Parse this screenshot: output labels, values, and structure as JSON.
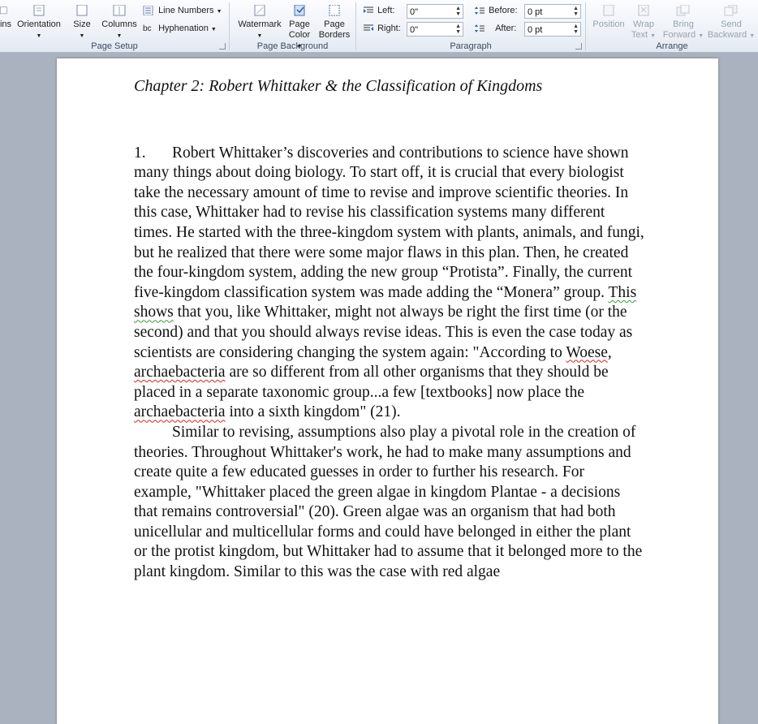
{
  "ribbon": {
    "page_setup": {
      "label": "Page Setup",
      "margins_label": "ins",
      "orientation_label": "Orientation",
      "size_label": "Size",
      "columns_label": "Columns",
      "line_numbers_label": "Line Numbers",
      "hyphenation_label": "Hyphenation"
    },
    "page_background": {
      "label": "Page Background",
      "watermark_label": "Watermark",
      "page_color_label_1": "Page",
      "page_color_label_2": "Color",
      "page_borders_label_1": "Page",
      "page_borders_label_2": "Borders"
    },
    "paragraph": {
      "label": "Paragraph",
      "left_label": "Left:",
      "left_value": "0\"",
      "right_label": "Right:",
      "right_value": "0\"",
      "before_label": "Before:",
      "before_value": "0 pt",
      "after_label": "After:",
      "after_value": "0 pt"
    },
    "arrange": {
      "label": "Arrange",
      "position_label": "Position",
      "wrap_text_label_1": "Wrap",
      "wrap_text_label_2": "Text",
      "bring_forward_label_1": "Bring",
      "bring_forward_label_2": "Forward",
      "send_backward_label_1": "Send",
      "send_backward_label_2": "Backward"
    }
  },
  "document": {
    "chapter_title": "Chapter 2: Robert Whittaker & the Classification of Kingdoms",
    "para1_number": "1.",
    "para1": {
      "t1": "Robert Whittaker’s discoveries and contributions to science have shown many things about doing biology. To start off, it is crucial that every biologist take the necessary amount of time to revise and improve scientific theories. In this case, Whittaker had to revise his classification systems many different times. He started with the three-kingdom system with plants, animals, and fungi, but he realized that there were some major flaws in this plan. Then, he created the four-kingdom system, adding the new group “Protista”. Finally, the current five-kingdom classification system was made adding the “Monera” group. ",
      "g1": "This shows",
      "t2": " that you, like Whittaker, might not always be right the first time (or the second) and that you should always revise ideas. This is even the case today as scientists are considering changing the system again: \"According to ",
      "s1": "Woese",
      "t3": ", ",
      "s2": "archaebacteria",
      "t4": " are so different from all other organisms that they should be placed in a separate taxonomic group...a few [textbooks] now place the ",
      "s3": "archaebacteria",
      "t5": " into a sixth kingdom\" (21)."
    },
    "para2": "Similar to revising, assumptions also play a pivotal role in the creation of theories. Throughout Whittaker's work, he had to make many assumptions and create quite a few educated guesses in order to further his research. For example, \"Whittaker placed the green algae in kingdom Plantae - a decisions that remains controversial\" (20). Green algae was an organism that had both unicellular and multicellular forms and could have belonged in either the plant or the protist kingdom, but Whittaker had to assume that it belonged more to the plant kingdom. Similar to this was the case with red algae"
  }
}
